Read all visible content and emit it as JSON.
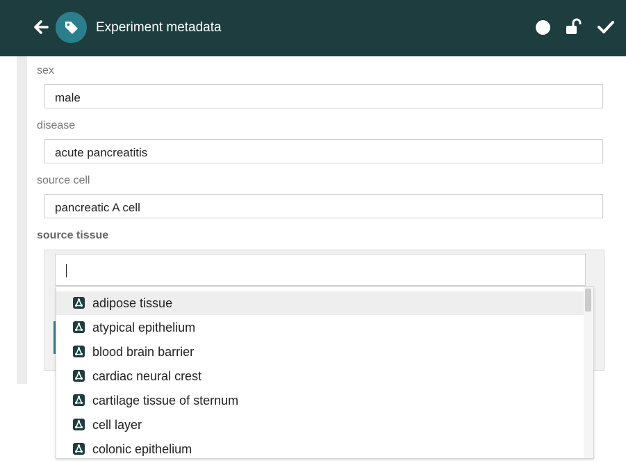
{
  "header": {
    "title": "Experiment metadata",
    "icons": [
      "back-arrow-icon",
      "tag-icon",
      "status-dot-icon",
      "unlock-icon",
      "check-icon"
    ],
    "background_color": "#1e3d3f",
    "accent_color": "#2b7f8d"
  },
  "fields": {
    "sex": {
      "label": "sex",
      "value": "male"
    },
    "disease": {
      "label": "disease",
      "value": "acute pancreatitis"
    },
    "source_cell": {
      "label": "source cell",
      "value": "pancreatic A cell"
    },
    "source_tissue": {
      "label": "source tissue",
      "value": ""
    }
  },
  "dropdown": {
    "item_icon": "ontology-term-icon",
    "items": [
      "adipose tissue",
      "atypical epithelium",
      "blood brain barrier",
      "cardiac neural crest",
      "cartilage tissue of sternum",
      "cell layer",
      "colonic epithelium"
    ],
    "highlighted_index": 0
  }
}
